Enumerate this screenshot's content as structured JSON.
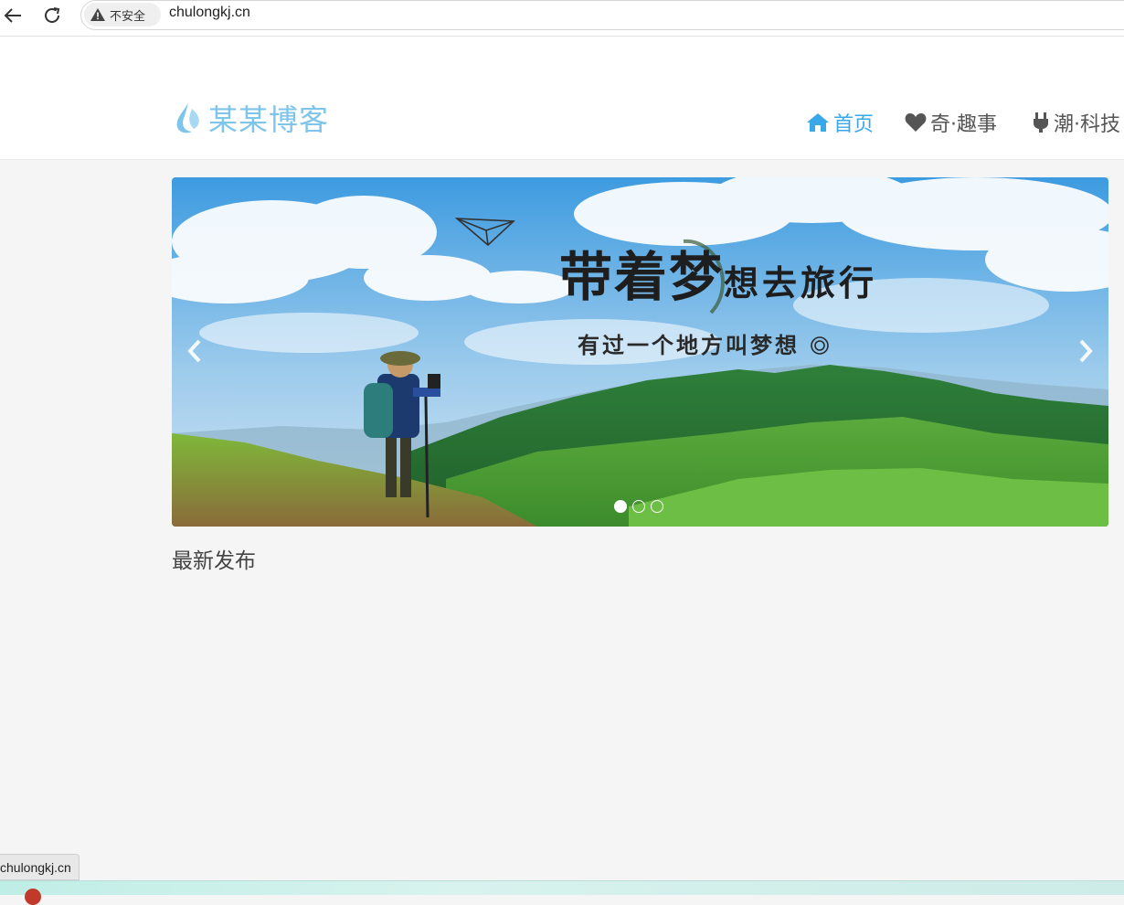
{
  "browser": {
    "security_label": "不安全",
    "url": "chulongkj.cn"
  },
  "site": {
    "logo_text": "某某博客",
    "nav": [
      {
        "label": "首页",
        "icon": "home-icon",
        "active": true
      },
      {
        "label": "奇·趣事",
        "icon": "heart-icon",
        "active": false
      },
      {
        "label": "潮·科技",
        "icon": "plug-icon",
        "active": false
      }
    ],
    "accent_color": "#3aa7e8",
    "logo_color": "#7fc4ea"
  },
  "carousel": {
    "slide_title_big_1": "带着梦",
    "slide_title_small": "想去旅行",
    "slide_subtitle": "有过一个地方叫梦想",
    "slide_count": 3,
    "active_slide": 1
  },
  "content": {
    "section_title": "最新发布"
  },
  "status_bar": {
    "hover_url": "chulongkj.cn"
  }
}
